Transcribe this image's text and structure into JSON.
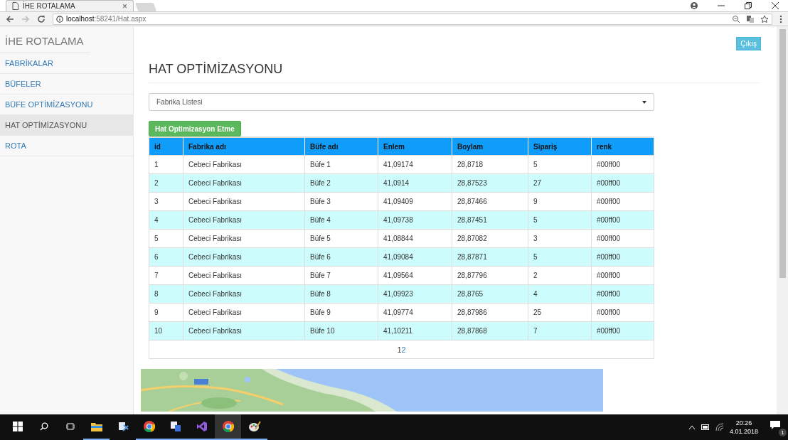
{
  "browser": {
    "tab": {
      "title": "İHE ROTALAMA",
      "close": "×"
    },
    "address": {
      "host": "localhost",
      "path": ":58241/Hat.aspx"
    }
  },
  "sidebar": {
    "brand": "İHE ROTALAMA",
    "items": [
      {
        "label": "FABRİKALAR",
        "selected": false
      },
      {
        "label": "BÜFELER",
        "selected": false
      },
      {
        "label": "BÜFE OPTİMİZASYONU",
        "selected": false
      },
      {
        "label": "HAT OPTİMİZASYONU",
        "selected": true
      },
      {
        "label": "ROTA",
        "selected": false
      }
    ]
  },
  "logout_button": "Çıkış",
  "page_title": "HAT OPTİMİZASYONU",
  "factory_select": {
    "value": "Fabrika Listesi"
  },
  "optimize_button": "Hat Optimizasyon Etme",
  "table": {
    "columns": [
      "id",
      "Fabrika adı",
      "Büfe adı",
      "Enlem",
      "Boylam",
      "Sipariş",
      "renk"
    ],
    "rows": [
      [
        "1",
        "Cebeci Fabrikası",
        "Büfe 1",
        "41,09174",
        "28,8718",
        "5",
        "#00ff00"
      ],
      [
        "2",
        "Cebeci Fabrikası",
        "Büfe 2",
        "41,0914",
        "28,87523",
        "27",
        "#00ff00"
      ],
      [
        "3",
        "Cebeci Fabrikası",
        "Büfe 3",
        "41,09409",
        "28,87466",
        "9",
        "#00ff00"
      ],
      [
        "4",
        "Cebeci Fabrikası",
        "Büfe 4",
        "41,09738",
        "28,87451",
        "5",
        "#00ff00"
      ],
      [
        "5",
        "Cebeci Fabrikası",
        "Büfe 5",
        "41,08844",
        "28,87082",
        "3",
        "#00ff00"
      ],
      [
        "6",
        "Cebeci Fabrikası",
        "Büfe 6",
        "41,09084",
        "28,87871",
        "5",
        "#00ff00"
      ],
      [
        "7",
        "Cebeci Fabrikası",
        "Büfe 7",
        "41,09564",
        "28,87796",
        "2",
        "#00ff00"
      ],
      [
        "8",
        "Cebeci Fabrikası",
        "Büfe 8",
        "41,09923",
        "28,8765",
        "4",
        "#00ff00"
      ],
      [
        "9",
        "Cebeci Fabrikası",
        "Büfe 9",
        "41,09774",
        "28,87986",
        "25",
        "#00ff00"
      ],
      [
        "10",
        "Cebeci Fabrikası",
        "Büfe 10",
        "41,10211",
        "28,87868",
        "7",
        "#00ff00"
      ]
    ],
    "pages": [
      {
        "label": "1",
        "selected": true
      },
      {
        "label": "2",
        "selected": false
      }
    ]
  },
  "taskbar": {
    "time": "20:26",
    "date": "4.01.2018",
    "notification_count": "1"
  }
}
